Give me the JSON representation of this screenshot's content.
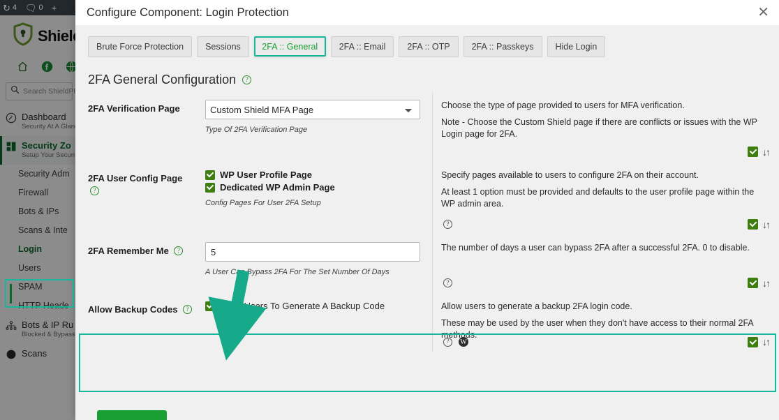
{
  "adminbar": {
    "items": [
      {
        "icon": "refresh-icon",
        "glyph": "↻",
        "label": "4"
      },
      {
        "icon": "comment-icon",
        "glyph": "⬜",
        "label": "0"
      },
      {
        "icon": "plus-icon",
        "glyph": "+",
        "label": ""
      }
    ]
  },
  "sidebar": {
    "brand": "Shield",
    "quick_icons": [
      "home-icon",
      "facebook-icon",
      "globe-icon"
    ],
    "search": {
      "placeholder": "Search ShieldPRO",
      "value": ""
    },
    "groups": [
      {
        "icon": "dashboard-icon",
        "title": "Dashboard",
        "subtitle": "Security At A Glance",
        "active": false
      },
      {
        "icon": "security-zones-icon",
        "title": "Security Zo",
        "subtitle": "Setup Your Securi",
        "active": true
      }
    ],
    "subitems": [
      {
        "label": "Security Adm",
        "selected": false
      },
      {
        "label": "Firewall",
        "selected": false
      },
      {
        "label": "Bots & IPs",
        "selected": false
      },
      {
        "label": "Scans & Inte",
        "selected": false
      },
      {
        "label": "Login",
        "selected": true
      },
      {
        "label": "Users",
        "selected": false
      },
      {
        "label": "SPAM",
        "selected": false
      },
      {
        "label": "HTTP Heade",
        "selected": false
      }
    ],
    "groups_bottom": [
      {
        "icon": "bots-rules-icon",
        "title": "Bots & IP Ru",
        "subtitle": "Blocked & Bypass",
        "active": false
      },
      {
        "icon": "scans-icon",
        "title": "Scans",
        "subtitle": "",
        "active": false
      }
    ]
  },
  "modal": {
    "title": "Configure Component: Login Protection",
    "close_icon": "close-icon",
    "tabs": [
      {
        "label": "Brute Force Protection",
        "active": false
      },
      {
        "label": "Sessions",
        "active": false
      },
      {
        "label": "2FA :: General",
        "active": true
      },
      {
        "label": "2FA :: Email",
        "active": false
      },
      {
        "label": "2FA :: OTP",
        "active": false
      },
      {
        "label": "2FA :: Passkeys",
        "active": false
      },
      {
        "label": "Hide Login",
        "active": false
      }
    ],
    "section_heading": "2FA General Configuration",
    "rows": [
      {
        "label": "2FA Verification Page",
        "label_has_help": false,
        "control_type": "select",
        "value": "Custom Shield MFA Page",
        "hint": "Type Of 2FA Verification Page",
        "desc": [
          "Choose the type of page provided to users for MFA verification.",
          "Note - Choose the Custom Shield page if there are conflicts or issues with the WP Login page for 2FA."
        ],
        "desc_icons": [],
        "enabled": true
      },
      {
        "label": "2FA User Config Page",
        "label_has_help": true,
        "control_type": "checkboxes",
        "checkboxes": [
          {
            "label": "WP User Profile Page",
            "checked": true
          },
          {
            "label": "Dedicated WP Admin Page",
            "checked": true
          }
        ],
        "hint": "Config Pages For User 2FA Setup",
        "desc": [
          "Specify pages available to users to configure 2FA on their account.",
          "At least 1 option must be provided and defaults to the user profile page within the WP admin area."
        ],
        "desc_icons": [
          "help-icon"
        ],
        "enabled": true
      },
      {
        "label": "2FA Remember Me",
        "label_has_help": true,
        "control_type": "number",
        "value": "5",
        "hint": "A User Can Bypass 2FA For The Set Number Of Days",
        "desc": [
          "The number of days a user can bypass 2FA after a successful 2FA. 0 to disable."
        ],
        "desc_icons": [
          "help-icon"
        ],
        "enabled": true
      },
      {
        "label": "Allow Backup Codes",
        "label_has_help": true,
        "control_type": "checkboxes",
        "checkboxes": [
          {
            "label": "Allow Users To Generate A Backup Code",
            "checked": true
          }
        ],
        "hint": "",
        "desc": [
          "Allow users to generate a backup 2FA login code.",
          "These may be used by the user when they don't have access to their normal 2FA methods."
        ],
        "desc_icons": [
          "help-icon",
          "wordpress-icon"
        ],
        "enabled": true,
        "highlighted": true
      }
    ],
    "save_button_label": ""
  },
  "annotation": {
    "arrow_color": "#16a98a",
    "highlight_color": "#16b79a"
  }
}
